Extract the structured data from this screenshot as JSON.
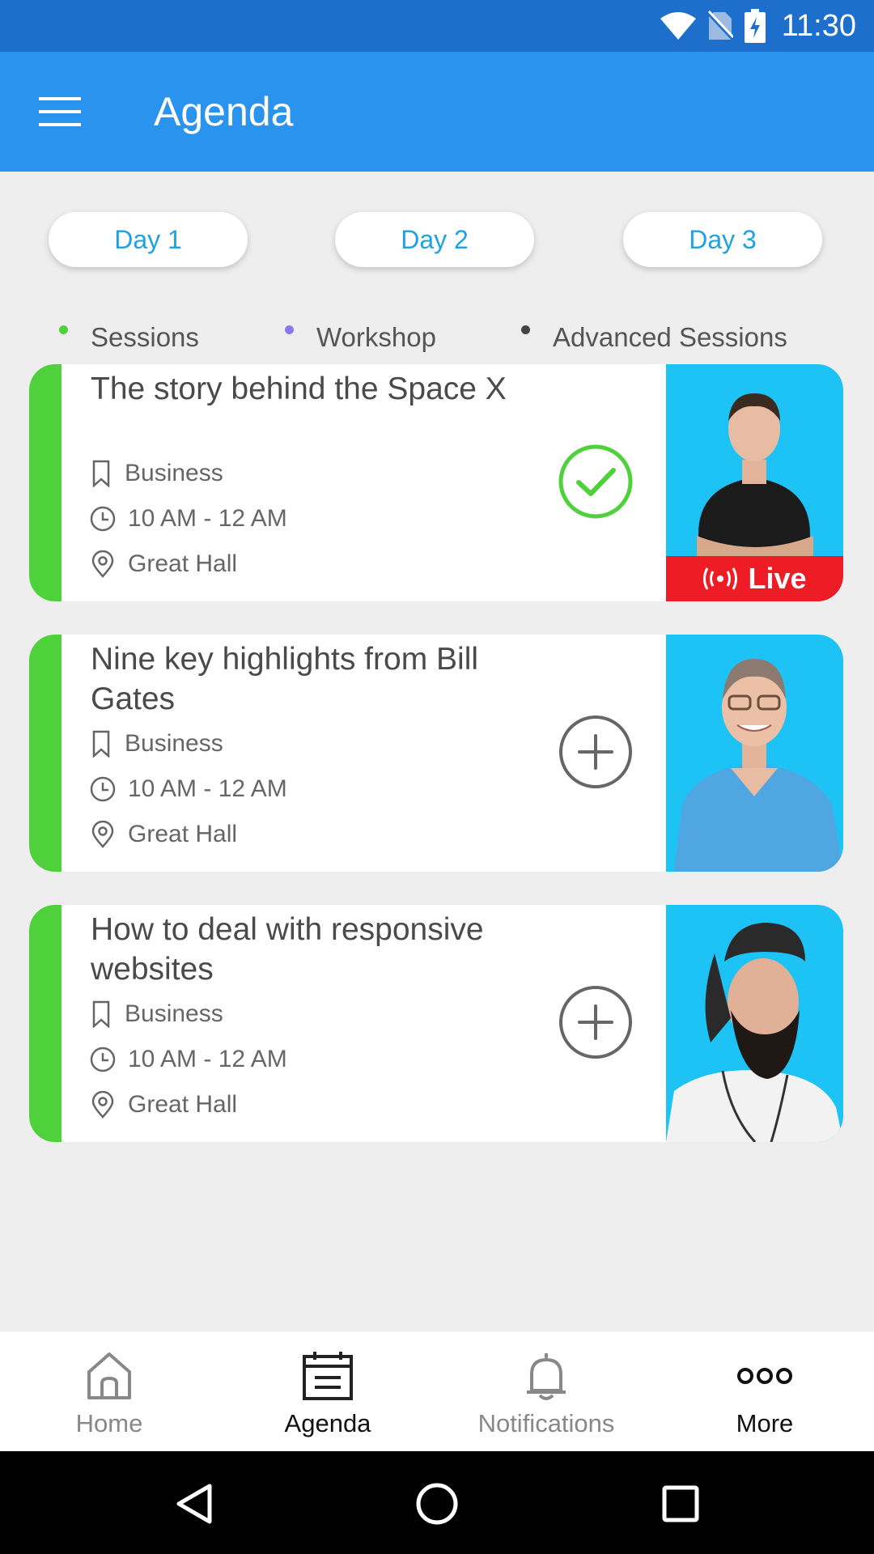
{
  "status_bar": {
    "time": "11:30",
    "icons": [
      "wifi-icon",
      "no-sim-icon",
      "battery-charging-icon"
    ]
  },
  "app_bar": {
    "title": "Agenda",
    "menu_icon": "hamburger-menu-icon"
  },
  "day_tabs": [
    {
      "label": "Day 1"
    },
    {
      "label": "Day 2"
    },
    {
      "label": "Day 3"
    }
  ],
  "legend": [
    {
      "label": "Sessions",
      "color": "#4fd13c"
    },
    {
      "label": "Workshop",
      "color": "#8a78ef"
    },
    {
      "label": "Advanced Sessions",
      "color": "#444444"
    }
  ],
  "sessions": [
    {
      "title": "The story behind the Space X",
      "category": "Business",
      "time": "10 AM - 12 AM",
      "location": "Great Hall",
      "status": "added",
      "action_icon": "check-circle-icon",
      "live_label": "Live",
      "stripe_color": "#4fd13c"
    },
    {
      "title": "Nine key highlights from Bill Gates",
      "category": "Business",
      "time": "10 AM - 12 AM",
      "location": "Great Hall",
      "status": "not-added",
      "action_icon": "add-circle-icon",
      "stripe_color": "#4fd13c"
    },
    {
      "title": "How to deal with responsive websites",
      "category": "Business",
      "time": "10 AM - 12 AM",
      "location": "Great Hall",
      "status": "not-added",
      "action_icon": "add-circle-icon",
      "stripe_color": "#4fd13c"
    }
  ],
  "bottom_nav": [
    {
      "label": "Home",
      "icon": "home-icon",
      "active": false
    },
    {
      "label": "Agenda",
      "icon": "calendar-icon",
      "active": true
    },
    {
      "label": "Notifications",
      "icon": "bell-icon",
      "active": false
    },
    {
      "label": "More",
      "icon": "more-dots-icon",
      "active": false
    }
  ],
  "colors": {
    "status_bar": "#1e6fcc",
    "app_bar": "#2a93ee",
    "accent_text": "#1fa2e0",
    "session_green": "#4fd13c",
    "live_red": "#ee1c25",
    "photo_bg": "#1cc3f4"
  }
}
